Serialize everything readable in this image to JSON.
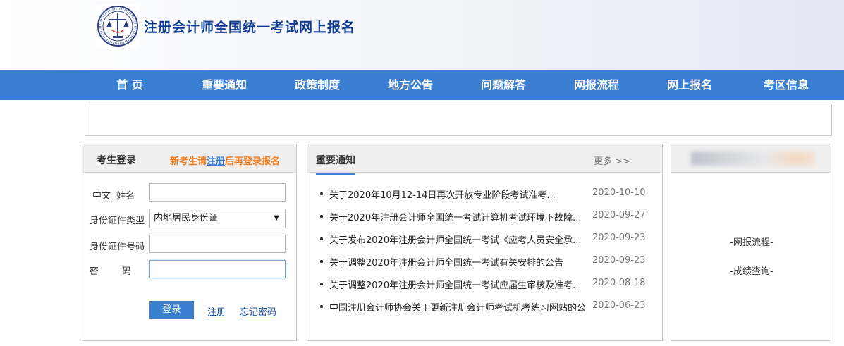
{
  "header": {
    "logo": "cicpa-seal-logo",
    "title": "注册会计师全国统一考试网上报名"
  },
  "nav": {
    "items": [
      "首 页",
      "重要通知",
      "政策制度",
      "地方公告",
      "问题解答",
      "网报流程",
      "网上报名",
      "考区信息"
    ]
  },
  "login": {
    "title": "考生登录",
    "tip_prefix": "新考生请",
    "tip_link": "注册",
    "tip_suffix": "后再登录报名",
    "name_label": "中文  姓名",
    "id_type_label": "身份证件类型",
    "id_type_value": "内地居民身份证",
    "id_number_label": "身份证件号码",
    "password_label": "密        码",
    "login_button": "登录",
    "register_link": "注册",
    "forgot_link": "忘记密码"
  },
  "notices": {
    "title": "重要通知",
    "more": "更多 >>",
    "items": [
      {
        "text": "关于2020年10月12-14日再次开放专业阶段考试准考...",
        "date": "2020-10-10"
      },
      {
        "text": "关于2020年注册会计师全国统一考试计算机考试环境下故障...",
        "date": "2020-09-27"
      },
      {
        "text": "关于发布2020年注册会计师全国统一考试《应考人员安全承...",
        "date": "2020-09-23"
      },
      {
        "text": "关于调整2020年注册会计师全国统一考试有关安排的公告",
        "date": "2020-09-23"
      },
      {
        "text": "关于调整2020年注册会计师全国统一考试应届生审核及准考...",
        "date": "2020-08-18"
      },
      {
        "text": "中国注册会计师协会关于更新注册会计师考试机考练习网站的公...",
        "date": "2020-06-23"
      }
    ]
  },
  "side": {
    "link1": "-网报流程-",
    "link2": "-成绩查询-"
  },
  "colors": {
    "brand_blue": "#3a7fd2",
    "title_blue": "#0f3a92",
    "tip_orange": "#f07b1f"
  }
}
